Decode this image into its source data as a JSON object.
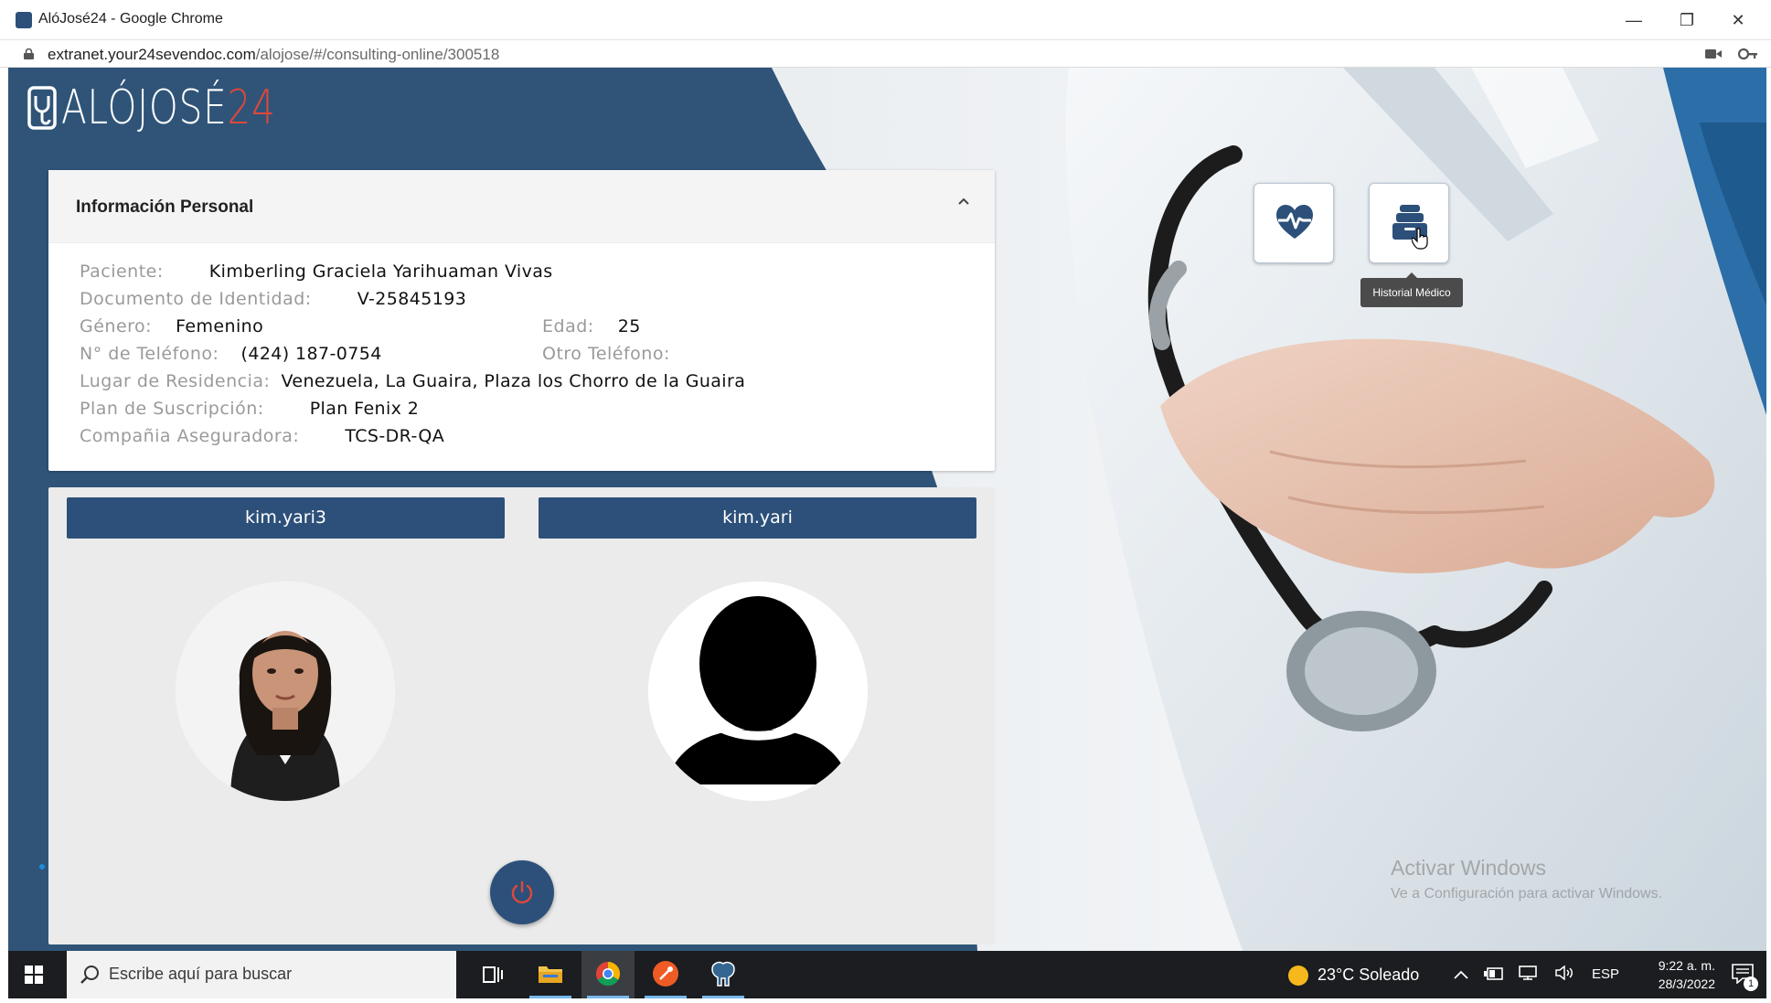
{
  "browser": {
    "window_title": "AlóJosé24 - Google Chrome",
    "url_host": "extranet.your24sevendoc.com",
    "url_path": "/alojose/#/consulting-online/300518",
    "minimize": "—",
    "restore": "❐",
    "close": "✕"
  },
  "app": {
    "logo_text": "ALÓJOSÉ",
    "logo_number": "24"
  },
  "personal_info": {
    "title": "Información Personal",
    "patient_label": "Paciente:",
    "patient_value": "Kimberling Graciela Yarihuaman Vivas",
    "id_label": "Documento de Identidad:",
    "id_value": "V-25845193",
    "gender_label": "Género:",
    "gender_value": "Femenino",
    "age_label": "Edad:",
    "age_value": "25",
    "phone_label": "N° de Teléfono:",
    "phone_value": "(424) 187-0754",
    "other_phone_label": "Otro Teléfono:",
    "other_phone_value": "",
    "residence_label": "Lugar de Residencia:",
    "residence_value": "Venezuela, La Guaira, Plaza los Chorro de la Guaira",
    "plan_label": "Plan de Suscripción:",
    "plan_value": "Plan Fenix 2",
    "insurer_label": "Compañia Aseguradora:",
    "insurer_value": "TCS-DR-QA"
  },
  "video_call": {
    "participant_1": "kim.yari3",
    "participant_2": "kim.yari"
  },
  "actions": {
    "tooltip": "Historial Médico"
  },
  "watermark": {
    "line1": "Activar Windows",
    "line2": "Ve a Configuración para activar Windows."
  },
  "taskbar": {
    "search_placeholder": "Escribe aquí para buscar",
    "weather": "23°C  Soleado",
    "language": "ESP",
    "time": "9:22 a. m.",
    "date": "28/3/2022",
    "notification_count": "1"
  },
  "colors": {
    "brand_blue": "#2c5079",
    "brand_red": "#e1473b",
    "taskbar": "#1b1d20"
  }
}
